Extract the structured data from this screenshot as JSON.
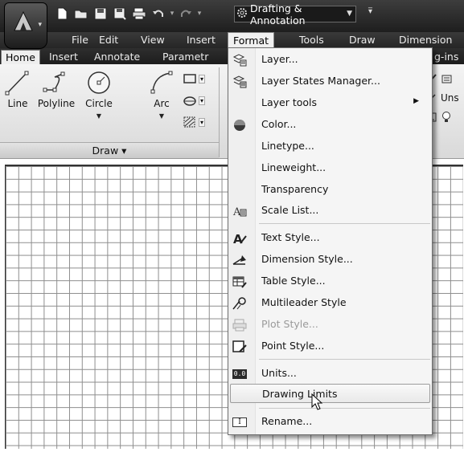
{
  "app": {
    "workspace_label": "Drafting & Annotation"
  },
  "menubar": {
    "items": [
      "File",
      "Edit",
      "View",
      "Insert",
      "Format",
      "Tools",
      "Draw",
      "Dimension"
    ]
  },
  "ribbon": {
    "tabs": [
      "Home",
      "Insert",
      "Annotate",
      "Parametr",
      "g-ins"
    ],
    "tools": {
      "line": "Line",
      "polyline": "Polyline",
      "circle": "Circle",
      "arc": "Arc"
    },
    "panel_title": "Draw ▾",
    "right_partial_label": "Uns"
  },
  "format_menu": {
    "items": [
      {
        "label": "Layer...",
        "icon": "layer-icon"
      },
      {
        "label": "Layer States Manager...",
        "icon": "layer-states-icon"
      },
      {
        "label": "Layer tools",
        "icon": "",
        "submenu": "▶"
      },
      {
        "label": "Color...",
        "icon": "color-icon"
      },
      {
        "label": "Linetype...",
        "icon": ""
      },
      {
        "label": "Lineweight...",
        "icon": ""
      },
      {
        "label": "Transparency",
        "icon": ""
      },
      {
        "label": "Scale List...",
        "icon": "scale-list-icon"
      },
      {
        "label": "Text Style...",
        "icon": "text-style-icon"
      },
      {
        "label": "Dimension Style...",
        "icon": "dimension-style-icon"
      },
      {
        "label": "Table Style...",
        "icon": "table-style-icon"
      },
      {
        "label": "Multileader Style",
        "icon": "multileader-style-icon"
      },
      {
        "label": "Plot Style...",
        "icon": "plot-style-icon",
        "disabled": true
      },
      {
        "label": "Point Style...",
        "icon": "point-style-icon"
      },
      {
        "label": "Units...",
        "icon": "units-icon",
        "icon_text": "0.0"
      },
      {
        "label": "Drawing Limits",
        "icon": "",
        "highlighted": true
      },
      {
        "label": "Rename...",
        "icon": "rename-icon",
        "icon_text": "I"
      }
    ]
  }
}
